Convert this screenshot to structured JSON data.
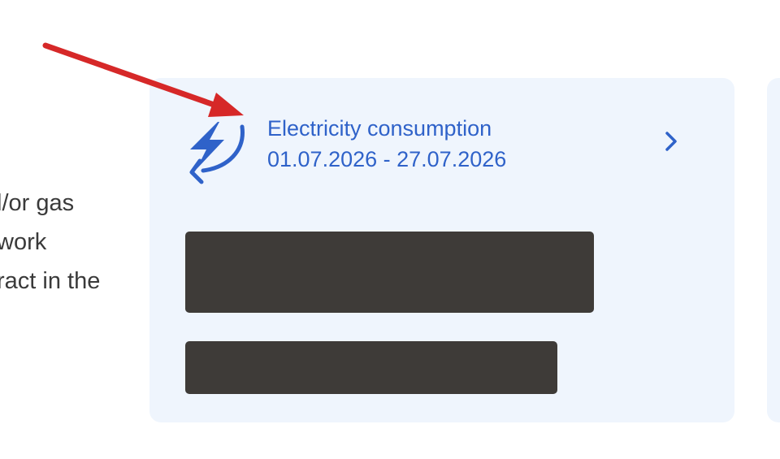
{
  "left_text": {
    "line1": "l/or gas",
    "line2": "work",
    "line3": "ract in the"
  },
  "card": {
    "title": "Electricity consumption",
    "date_range": "01.07.2026 - 27.07.2026",
    "icon": "electricity-cycle-icon",
    "chevron": "chevron-right-icon"
  },
  "colors": {
    "accent": "#2f62c9",
    "card_background": "#eff5fd",
    "redaction": "#3e3b38",
    "annotation_arrow": "#d62828",
    "text": "#3a3a3a"
  }
}
